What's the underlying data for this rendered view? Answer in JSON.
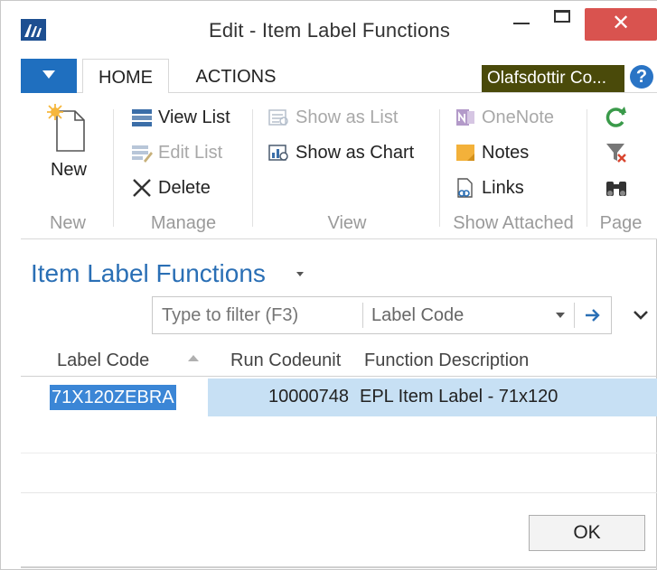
{
  "window": {
    "title": "Edit - Item Label Functions",
    "close_glyph": "✕"
  },
  "ribbon_tabs": {
    "home": "HOME",
    "actions": "ACTIONS",
    "company": "Olafsdottir Co...",
    "help": "?"
  },
  "ribbon": {
    "new_group": {
      "new": "New",
      "label": "New"
    },
    "manage_group": {
      "view_list": "View List",
      "edit_list": "Edit List",
      "delete": "Delete",
      "label": "Manage"
    },
    "view_group": {
      "show_as_list": "Show as List",
      "show_as_chart": "Show as Chart",
      "label": "View"
    },
    "show_attached_group": {
      "onenote": "OneNote",
      "notes": "Notes",
      "links": "Links",
      "label": "Show Attached"
    },
    "page_group": {
      "label": "Page"
    }
  },
  "page": {
    "title": "Item Label Functions"
  },
  "filter": {
    "placeholder": "Type to filter (F3)",
    "field": "Label Code"
  },
  "grid": {
    "headers": [
      "Label Code",
      "Run Codeunit",
      "Function Description"
    ],
    "rows": [
      {
        "label_code": "71X120ZEBRA",
        "run_codeunit": "10000748",
        "description": "EPL Item Label - 71x120"
      }
    ]
  },
  "footer": {
    "ok": "OK"
  },
  "colors": {
    "accent": "#2a6fb5",
    "selection": "#c7e0f4",
    "close": "#d9534f",
    "company_badge": "#4a4a0a"
  }
}
